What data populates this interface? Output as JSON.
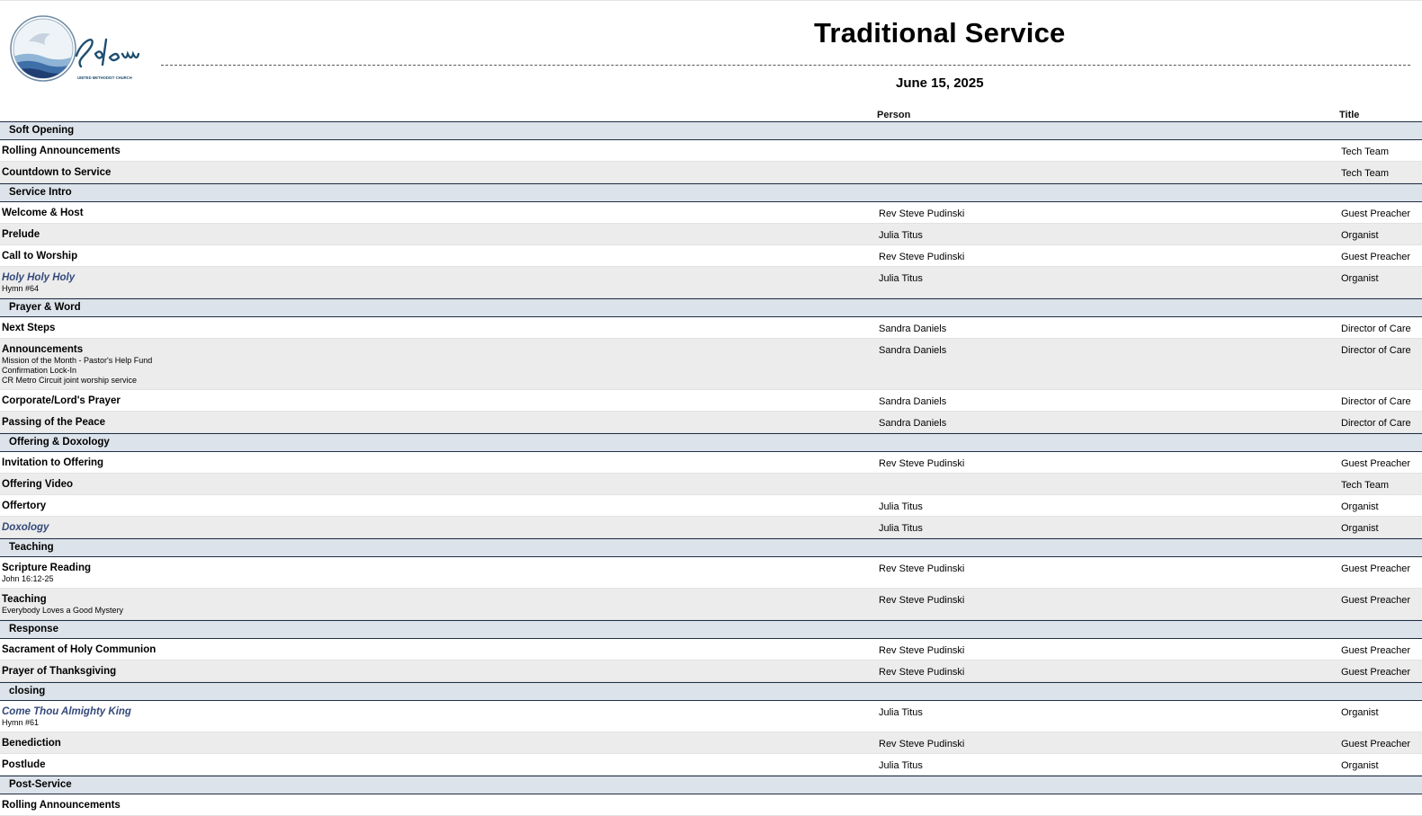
{
  "header": {
    "logo_text": "Salem",
    "logo_subtext": "UNITED METHODIST CHURCH",
    "title": "Traditional Service",
    "date": "June 15, 2025",
    "columns": {
      "person": "Person",
      "title": "Title"
    }
  },
  "rows": [
    {
      "kind": "section",
      "label": "Soft Opening"
    },
    {
      "kind": "item",
      "name": "Rolling Announcements",
      "person": "",
      "title": "Tech Team"
    },
    {
      "kind": "item",
      "name": "Countdown to Service",
      "person": "",
      "title": "Tech Team"
    },
    {
      "kind": "section",
      "label": "Service Intro"
    },
    {
      "kind": "item",
      "name": "Welcome & Host",
      "person": "Rev Steve Pudinski",
      "title": "Guest Preacher"
    },
    {
      "kind": "item",
      "name": "Prelude",
      "person": "Julia Titus",
      "title": "Organist"
    },
    {
      "kind": "item",
      "name": "Call to Worship",
      "person": "Rev Steve Pudinski",
      "title": "Guest Preacher"
    },
    {
      "kind": "item",
      "name": "Holy Holy Holy",
      "song": true,
      "notes": [
        "Hymn #64"
      ],
      "person": "Julia Titus",
      "title": "Organist"
    },
    {
      "kind": "section",
      "label": "Prayer & Word"
    },
    {
      "kind": "item",
      "name": "Next Steps",
      "person": "Sandra Daniels",
      "title": "Director of Care"
    },
    {
      "kind": "item",
      "name": "Announcements",
      "notes": [
        "Mission of the Month - Pastor's Help Fund",
        "Confirmation Lock-In",
        "CR Metro Circuit joint worship service"
      ],
      "person": "Sandra Daniels",
      "title": "Director of Care"
    },
    {
      "kind": "item",
      "name": "Corporate/Lord's Prayer",
      "person": "Sandra Daniels",
      "title": "Director of Care"
    },
    {
      "kind": "item",
      "name": "Passing of the Peace",
      "person": "Sandra Daniels",
      "title": "Director of Care"
    },
    {
      "kind": "section",
      "label": "Offering & Doxology"
    },
    {
      "kind": "item",
      "name": "Invitation to Offering",
      "person": "Rev Steve Pudinski",
      "title": "Guest Preacher"
    },
    {
      "kind": "item",
      "name": "Offering Video",
      "person": "",
      "title": "Tech Team"
    },
    {
      "kind": "item",
      "name": "Offertory",
      "person": "Julia Titus",
      "title": "Organist"
    },
    {
      "kind": "item",
      "name": "Doxology",
      "song": true,
      "person": "Julia Titus",
      "title": "Organist"
    },
    {
      "kind": "section",
      "label": "Teaching"
    },
    {
      "kind": "item",
      "name": "Scripture Reading",
      "notes": [
        "John 16:12-25"
      ],
      "person": "Rev Steve Pudinski",
      "title": "Guest Preacher"
    },
    {
      "kind": "item",
      "name": "Teaching",
      "notes": [
        "Everybody Loves a Good Mystery"
      ],
      "person": "Rev Steve Pudinski",
      "title": "Guest Preacher"
    },
    {
      "kind": "section",
      "label": "Response"
    },
    {
      "kind": "item",
      "name": "Sacrament of Holy Communion",
      "person": "Rev Steve Pudinski",
      "title": "Guest Preacher"
    },
    {
      "kind": "item",
      "name": "Prayer of Thanksgiving",
      "person": "Rev Steve Pudinski",
      "title": "Guest Preacher"
    },
    {
      "kind": "section",
      "label": "closing"
    },
    {
      "kind": "item",
      "name": "Come Thou Almighty King",
      "song": true,
      "notes": [
        "Hymn #61"
      ],
      "person": "Julia Titus",
      "title": "Organist"
    },
    {
      "kind": "item",
      "name": "Benediction",
      "person": "Rev Steve Pudinski",
      "title": "Guest Preacher"
    },
    {
      "kind": "item",
      "name": "Postlude",
      "person": "Julia Titus",
      "title": "Organist"
    },
    {
      "kind": "section",
      "label": "Post-Service"
    },
    {
      "kind": "item",
      "name": "Rolling Announcements",
      "person": "",
      "title": ""
    }
  ]
}
